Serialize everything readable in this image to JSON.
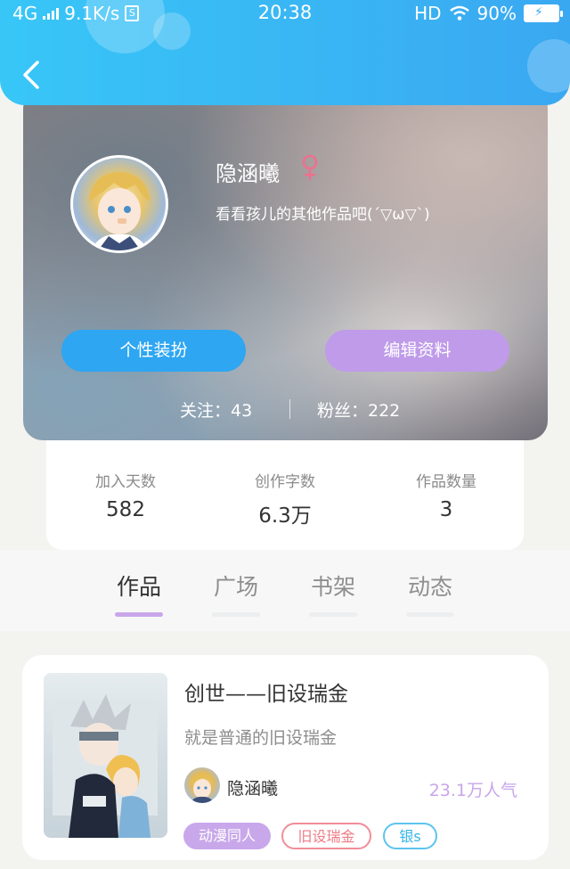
{
  "status_bar": {
    "network": "4G",
    "speed": "9.1K/s",
    "sim_label": "S",
    "time": "20:38",
    "hd": "HD",
    "battery": "90%"
  },
  "profile": {
    "username": "隐涵曦",
    "signature": "看看孩儿的其他作品吧(´▽ω▽`)",
    "decorate_label": "个性装扮",
    "edit_label": "编辑资料",
    "following": "关注：43",
    "followers": "粉丝：222"
  },
  "stats": [
    {
      "label": "加入天数",
      "value": "582"
    },
    {
      "label": "创作字数",
      "value": "6.3万"
    },
    {
      "label": "作品数量",
      "value": "3"
    }
  ],
  "tabs": [
    {
      "label": "作品",
      "active": true
    },
    {
      "label": "广场",
      "active": false
    },
    {
      "label": "书架",
      "active": false
    },
    {
      "label": "动态",
      "active": false
    }
  ],
  "work": {
    "title": "创世——旧设瑞金",
    "description": "就是普通的旧设瑞金",
    "author": "隐涵曦",
    "popularity": "23.1万人气",
    "tags": [
      "动漫同人",
      "旧设瑞金",
      "银s"
    ]
  },
  "colors": {
    "header": "#3aa8f1",
    "decorate_button": "#2ea6f2",
    "edit_button": "#bf9be9",
    "accent_purple": "#c8a8ea",
    "tag_pink": "#f08d99",
    "tag_blue": "#5cc4ef",
    "gender_pink": "#ef6f8f"
  },
  "icons": {
    "back": "chevron-left-icon",
    "gender": "female-icon",
    "wifi": "wifi-icon",
    "battery": "battery-charging-icon"
  }
}
